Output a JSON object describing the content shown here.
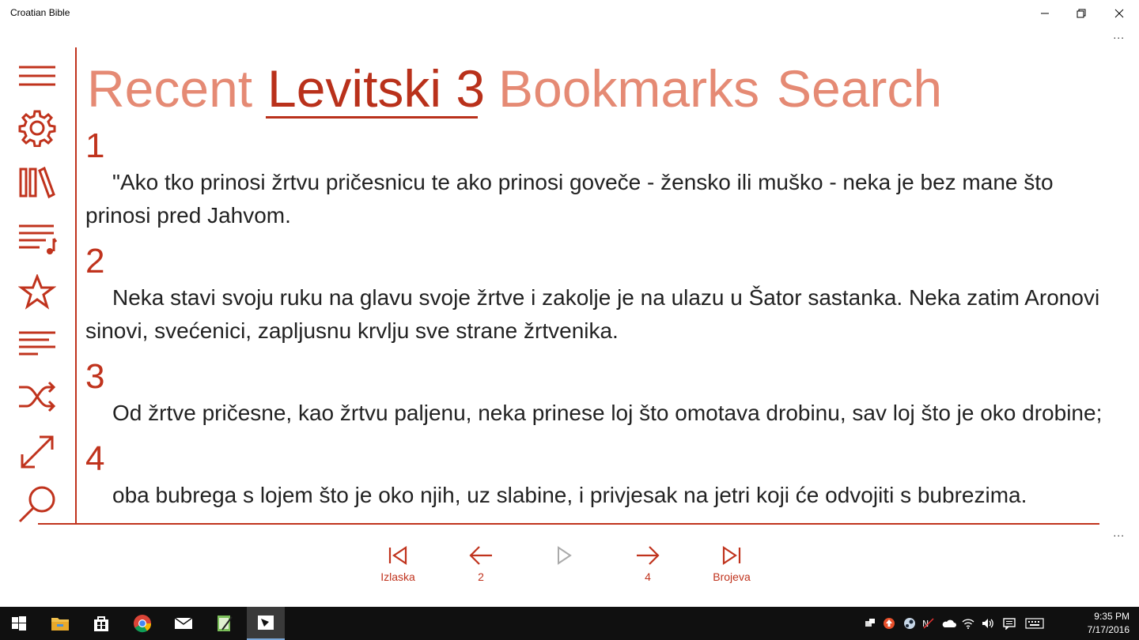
{
  "window": {
    "title": "Croatian Bible"
  },
  "sidebar": {
    "items": [
      {
        "icon": "hamburger-menu-icon"
      },
      {
        "icon": "gear-icon"
      },
      {
        "icon": "library-books-icon"
      },
      {
        "icon": "playlist-music-icon"
      },
      {
        "icon": "star-icon"
      },
      {
        "icon": "text-lines-icon"
      },
      {
        "icon": "shuffle-icon"
      },
      {
        "icon": "resize-diagonal-icon"
      },
      {
        "icon": "search-icon"
      }
    ]
  },
  "pivot": {
    "tabs": [
      "Recent",
      "Levitski 3",
      "Bookmarks",
      "Search"
    ],
    "active": "Levitski 3"
  },
  "verses": [
    {
      "num": "1",
      "text": "\"Ako tko prinosi žrtvu pričesnicu te ako prinosi goveče - žensko ili muško - neka je bez mane što prinosi pred Jahvom."
    },
    {
      "num": "2",
      "text": "Neka stavi svoju ruku na glavu svoje žrtve i zakolje je na ulazu u Šator sastanka. Neka zatim Aronovi sinovi, svećenici, zapljusnu krvlju sve strane žrtvenika."
    },
    {
      "num": "3",
      "text": "Od žrtve pričesne, kao žrtvu paljenu, neka prinese loj što omotava drobinu, sav loj što je oko drobine;"
    },
    {
      "num": "4",
      "text": "oba bubrega s lojem što je oko njih, uz slabine, i privjesak na jetri koji će odvojiti s bubrezima."
    }
  ],
  "nav": {
    "first_label": "Izlaska",
    "prev_label": "2",
    "next_label": "4",
    "last_label": "Brojeva"
  },
  "more_label": "...",
  "taskbar": {
    "time": "9:35 PM",
    "date": "7/17/2016"
  },
  "colors": {
    "accent": "#c0331d",
    "accent_light": "#e58a74"
  }
}
